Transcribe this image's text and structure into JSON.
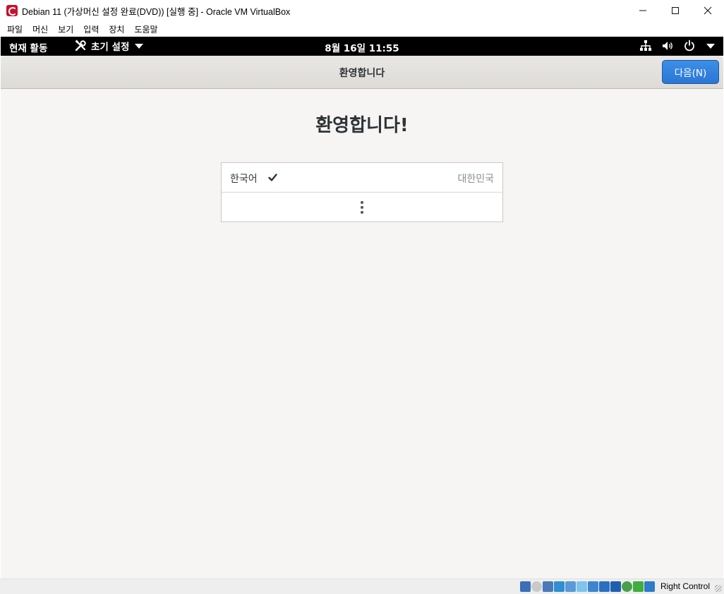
{
  "window": {
    "title": "Debian 11 (가상머신 설정 완료(DVD)) [실행 중] - Oracle VM VirtualBox",
    "minimize": "—",
    "maximize": "☐",
    "close": "✕"
  },
  "menubar": {
    "items": [
      "파일",
      "머신",
      "보기",
      "입력",
      "장치",
      "도움말"
    ]
  },
  "topbar": {
    "activities": "현재 활동",
    "app_menu": "초기 설정",
    "clock": "8월 16일  11:55",
    "tray_icons": [
      "network-icon",
      "volume-icon",
      "power-icon"
    ]
  },
  "headerbar": {
    "title": "환영합니다",
    "next_label": "다음(N)"
  },
  "main": {
    "heading": "환영합니다!",
    "languages": [
      {
        "name": "한국어",
        "selected": true,
        "region": "대한민국"
      }
    ],
    "more_icon": "more-vertical-icon"
  },
  "statusbar": {
    "host_key": "Right Control",
    "icons": [
      "hard-disk-icon",
      "optical-drive-icon",
      "audio-icon",
      "network-icon",
      "usb-icon",
      "shared-folders-icon",
      "display-icon",
      "recording-icon",
      "cpu-icon",
      "virtualization-icon",
      "mouse-integration-icon",
      "keyboard-icon"
    ]
  },
  "colors": {
    "accent": "#2a76d6",
    "topbar_bg": "#000000",
    "content_bg": "#f6f5f4"
  }
}
